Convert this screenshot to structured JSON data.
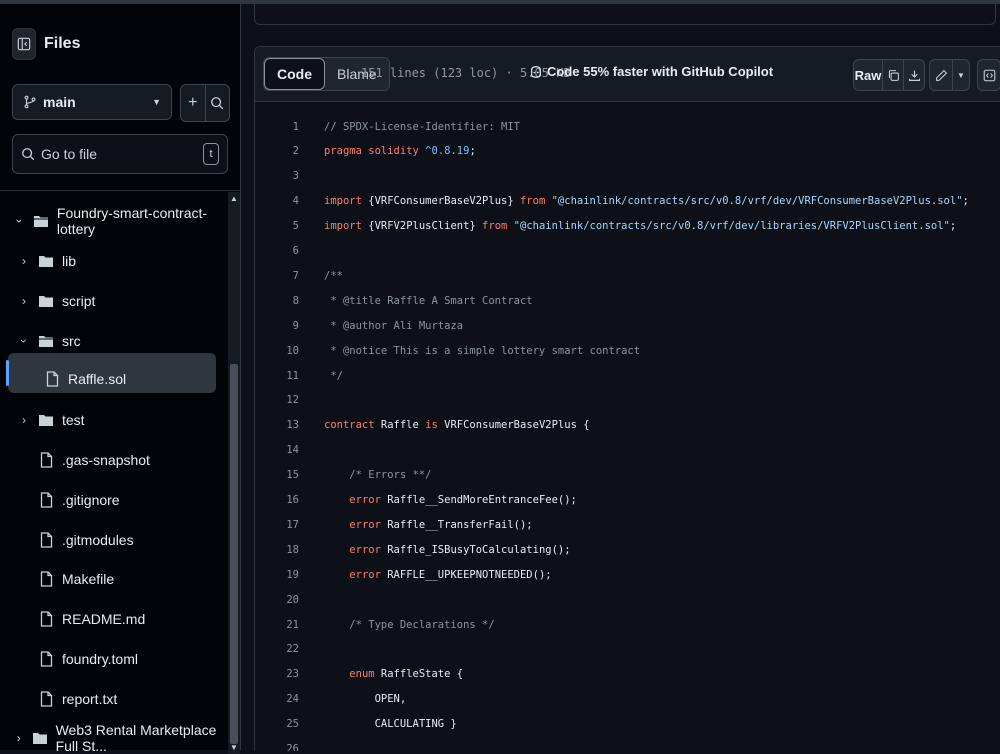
{
  "sidebar": {
    "title": "Files",
    "branch": "main",
    "search_placeholder": "Go to file",
    "search_shortcut": "t",
    "tree": [
      {
        "label": "Foundry-smart-contract-lottery",
        "type": "folder",
        "open": true,
        "depth": 0
      },
      {
        "label": "lib",
        "type": "folder",
        "open": false,
        "depth": 1
      },
      {
        "label": "script",
        "type": "folder",
        "open": false,
        "depth": 1
      },
      {
        "label": "src",
        "type": "folder",
        "open": true,
        "depth": 1
      },
      {
        "label": "Raffle.sol",
        "type": "file",
        "selected": true,
        "depth": 2
      },
      {
        "label": "test",
        "type": "folder",
        "open": false,
        "depth": 1
      },
      {
        "label": ".gas-snapshot",
        "type": "file",
        "depth": 1
      },
      {
        "label": ".gitignore",
        "type": "file",
        "depth": 1
      },
      {
        "label": ".gitmodules",
        "type": "file",
        "depth": 1
      },
      {
        "label": "Makefile",
        "type": "file",
        "depth": 1
      },
      {
        "label": "README.md",
        "type": "file",
        "depth": 1
      },
      {
        "label": "foundry.toml",
        "type": "file",
        "depth": 1
      },
      {
        "label": "report.txt",
        "type": "file",
        "depth": 1
      },
      {
        "label": "Web3 Rental Marketplace Full St...",
        "type": "folder",
        "open": false,
        "depth": 0
      }
    ]
  },
  "header": {
    "tab_code": "Code",
    "tab_blame": "Blame",
    "file_stats": "151 lines (123 loc) · 5.05 KB",
    "copilot_text": "Code 55% faster with GitHub Copilot",
    "raw_label": "Raw"
  },
  "code_lines": [
    {
      "n": "1",
      "t": "// SPDX-License-Identifier: MIT"
    },
    {
      "n": "2",
      "t": "pragma solidity ^0.8.19;"
    },
    {
      "n": "3",
      "t": ""
    },
    {
      "n": "4",
      "t": "import {VRFConsumerBaseV2Plus} from \"@chainlink/contracts/src/v0.8/vrf/dev/VRFConsumerBaseV2Plus.sol\";"
    },
    {
      "n": "5",
      "t": "import {VRFV2PlusClient} from \"@chainlink/contracts/src/v0.8/vrf/dev/libraries/VRFV2PlusClient.sol\";"
    },
    {
      "n": "6",
      "t": ""
    },
    {
      "n": "7",
      "t": "/**"
    },
    {
      "n": "8",
      "t": " * @title Raffle A Smart Contract"
    },
    {
      "n": "9",
      "t": " * @author Ali Murtaza"
    },
    {
      "n": "10",
      "t": " * @notice This is a simple lottery smart contract"
    },
    {
      "n": "11",
      "t": " */"
    },
    {
      "n": "12",
      "t": ""
    },
    {
      "n": "13",
      "t": "contract Raffle is VRFConsumerBaseV2Plus {"
    },
    {
      "n": "14",
      "t": ""
    },
    {
      "n": "15",
      "t": "    /* Errors **/"
    },
    {
      "n": "16",
      "t": "    error Raffle__SendMoreEntranceFee();"
    },
    {
      "n": "17",
      "t": "    error Raffle__TransferFail();"
    },
    {
      "n": "18",
      "t": "    error Raffle_ISBusyToCalculating();"
    },
    {
      "n": "19",
      "t": "    error RAFFLE__UPKEEPNOTNEEDED();"
    },
    {
      "n": "20",
      "t": ""
    },
    {
      "n": "21",
      "t": "    /* Type Declarations */"
    },
    {
      "n": "22",
      "t": ""
    },
    {
      "n": "23",
      "t": "    enum RaffleState {"
    },
    {
      "n": "24",
      "t": "        OPEN,"
    },
    {
      "n": "25",
      "t": "        CALCULATING }"
    },
    {
      "n": "26",
      "t": ""
    }
  ]
}
